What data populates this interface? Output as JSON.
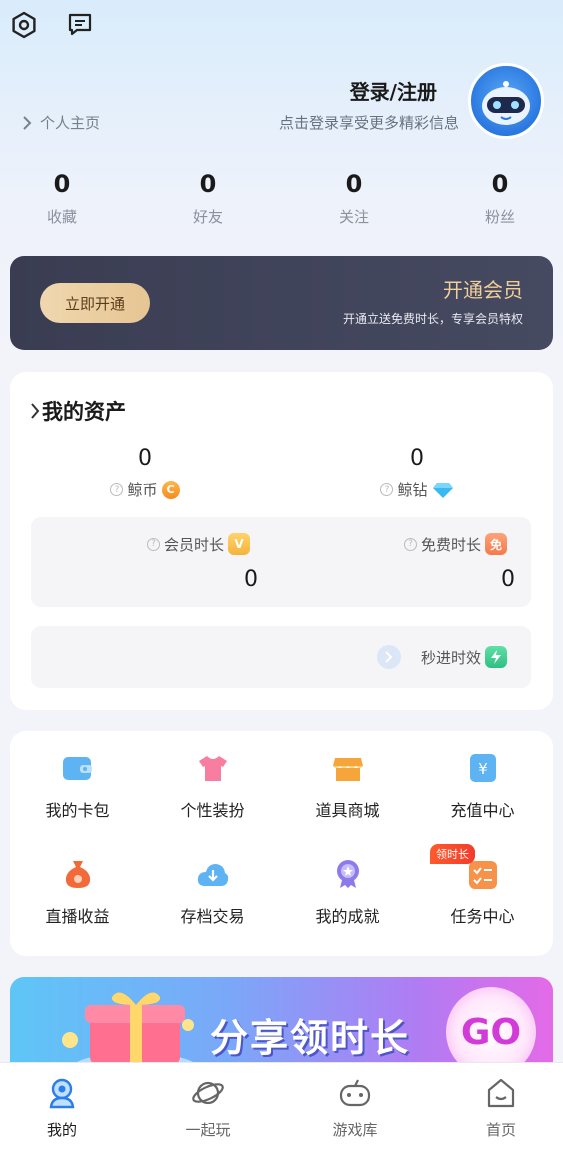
{
  "header": {
    "login_title": "登录/注册",
    "login_sub": "点击登录享受更多精彩信息",
    "home_link": "个人主页"
  },
  "stats": [
    {
      "num": "0",
      "label": "收藏"
    },
    {
      "num": "0",
      "label": "好友"
    },
    {
      "num": "0",
      "label": "关注"
    },
    {
      "num": "0",
      "label": "粉丝"
    }
  ],
  "vip": {
    "button": "立即开通",
    "title": "开通会员",
    "subtitle": "开通立送免费时长，专享会员特权"
  },
  "assets": {
    "title": "我的资产",
    "coins": {
      "num": "0",
      "label": "鲸币",
      "icon": "C"
    },
    "diamonds": {
      "num": "0",
      "label": "鲸钻"
    },
    "member_time": {
      "label": "会员时长",
      "num": "0",
      "badge": "V"
    },
    "free_time": {
      "label": "免费时长",
      "num": "0",
      "badge": "免"
    },
    "quick": {
      "label": "秒进时效"
    }
  },
  "grid": [
    {
      "label": "我的卡包",
      "icon": "wallet-icon"
    },
    {
      "label": "个性装扮",
      "icon": "shirt-icon"
    },
    {
      "label": "道具商城",
      "icon": "shop-icon"
    },
    {
      "label": "充值中心",
      "icon": "recharge-icon"
    },
    {
      "label": "直播收益",
      "icon": "money-bag-icon"
    },
    {
      "label": "存档交易",
      "icon": "cloud-download-icon"
    },
    {
      "label": "我的成就",
      "icon": "medal-icon"
    },
    {
      "label": "任务中心",
      "icon": "task-icon",
      "tag": "领时长"
    }
  ],
  "promo": {
    "text": "分享领时长",
    "go": "GO"
  },
  "nav": [
    {
      "label": "我的",
      "icon": "user-icon"
    },
    {
      "label": "一起玩",
      "icon": "planet-icon"
    },
    {
      "label": "游戏库",
      "icon": "gamepad-icon"
    },
    {
      "label": "首页",
      "icon": "home-icon"
    }
  ]
}
